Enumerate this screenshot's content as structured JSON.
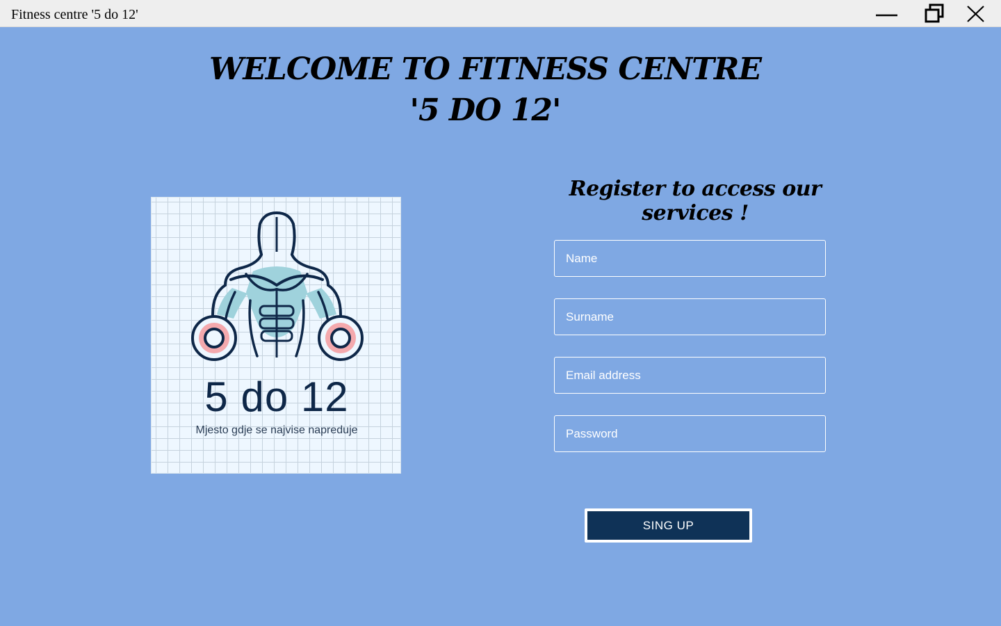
{
  "window": {
    "title": "Fitness centre '5 do 12'",
    "controls": [
      "minimize-icon",
      "restore-icon",
      "close-icon"
    ]
  },
  "header": {
    "line1": "WELCOME TO FITNESS CENTRE",
    "line2": "'5 DO 12'"
  },
  "register": {
    "heading": "Register to access our services !"
  },
  "logo": {
    "number": "5 do 12",
    "tagline": "Mjesto gdje se najvise napreduje",
    "icon": "muscle-torso-dumbbell-icon"
  },
  "form": {
    "name_placeholder": "Name",
    "surname_placeholder": "Surname",
    "email_placeholder": "Email address",
    "password_placeholder": "Password",
    "submit_label": "SING UP"
  },
  "colors": {
    "background": "#7fa8e3",
    "button": "#0f3257",
    "logo_navy": "#0e2748",
    "logo_teal": "#9fd2dc",
    "logo_pink": "#f4a9ad"
  }
}
